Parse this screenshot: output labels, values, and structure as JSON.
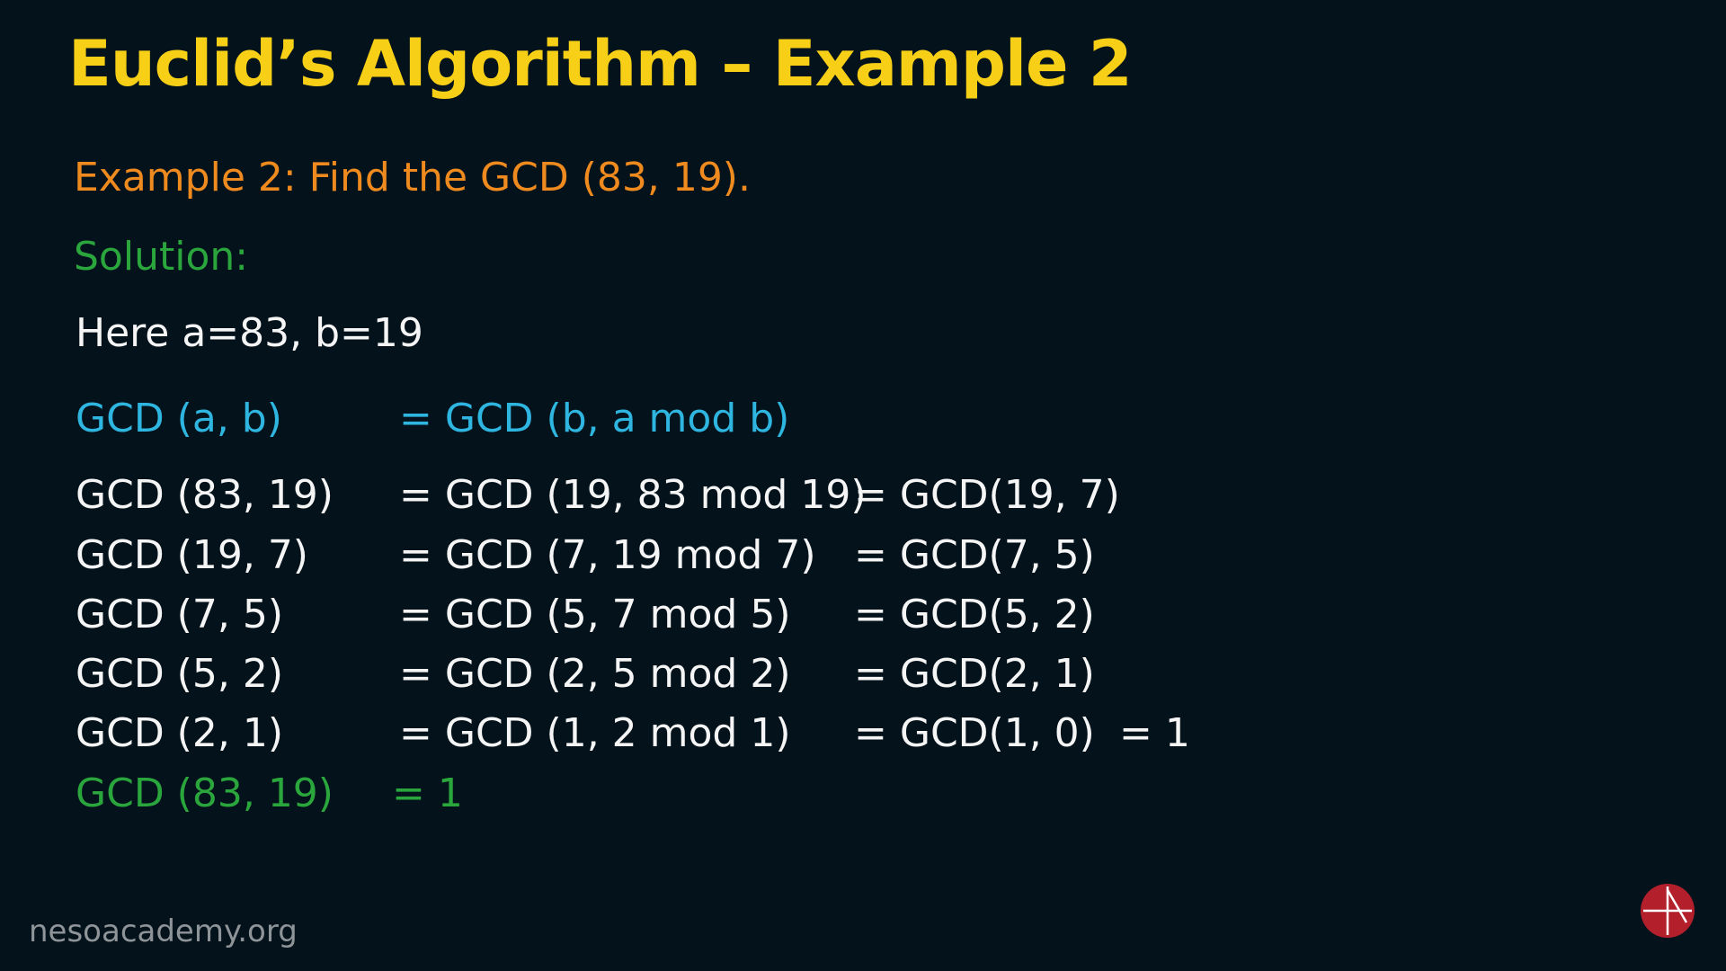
{
  "slide": {
    "title": "Euclid’s Algorithm – Example 2",
    "problem": "Example 2: Find the GCD (83, 19).",
    "solution_label": "Solution:",
    "given": "Here a=83, b=19",
    "formula": {
      "lhs": "GCD (a, b)",
      "rhs": "= GCD (b, a mod b)"
    },
    "steps": [
      {
        "lhs": "GCD (83, 19)",
        "mid": "= GCD (19, 83 mod 19)",
        "rhs": "= GCD(19, 7)",
        "result": ""
      },
      {
        "lhs": "GCD (19, 7)",
        "mid": "= GCD (7, 19 mod 7)",
        "rhs": "= GCD(7, 5)",
        "result": ""
      },
      {
        "lhs": "GCD (7, 5)",
        "mid": "= GCD (5, 7 mod 5)",
        "rhs": "= GCD(5, 2)",
        "result": ""
      },
      {
        "lhs": "GCD (5, 2)",
        "mid": "= GCD (2, 5 mod 2)",
        "rhs": "= GCD(2, 1)",
        "result": ""
      },
      {
        "lhs": "GCD (2, 1)",
        "mid": "= GCD (1, 2 mod 1)",
        "rhs": "= GCD(1, 0)",
        "result": "= 1"
      }
    ],
    "answer": {
      "lhs": "GCD (83, 19)",
      "rhs": "= 1"
    },
    "watermark": "nesoacademy.org",
    "logo_icon": "neso-academy-logo-icon"
  },
  "colors": {
    "background": "#03121b",
    "title": "#f6cf16",
    "problem": "#ef8a1f",
    "solution": "#2aa63d",
    "formula": "#2fb6e0",
    "text": "#f5f5f5",
    "logo": "#b3202c"
  }
}
